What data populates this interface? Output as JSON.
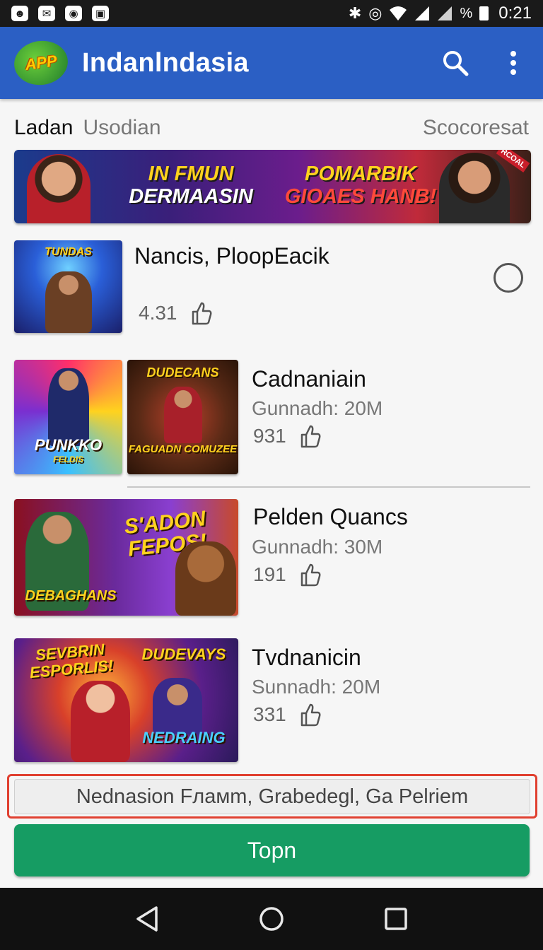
{
  "status_bar": {
    "left_icons": [
      "notification-icon",
      "chat-icon",
      "app-icon",
      "gallery-icon"
    ],
    "right_icons": [
      "bluetooth-icon",
      "sync-icon",
      "wifi-icon",
      "signal-icon",
      "battery-icon"
    ],
    "percent_symbol": "%",
    "time": "0:21"
  },
  "app_bar": {
    "logo_text": "APP",
    "title": "Indanlndasia",
    "actions": [
      "search-icon",
      "more-vert-icon"
    ]
  },
  "tabs": {
    "active": "Ladan",
    "inactive": "Usodian",
    "right": "Scocoresat"
  },
  "banner": {
    "left_line1": "IN FMUN",
    "left_line2": "DERMAASIN",
    "right_line1": "POMARBIK",
    "right_line2": "GIOAES HANB!",
    "corner": "RCOAL"
  },
  "items": [
    {
      "title": "Nancis, PloopEacik",
      "count": "4.31",
      "thumb_text": "TUNDAS"
    },
    {
      "title": "Cadnaniain",
      "subtitle": "Gunnadh: 20M",
      "count": "931",
      "thumb1_text": "PUNKKO",
      "thumb1_sub": "FELDIS",
      "thumb2_text": "DUDECANS",
      "thumb2_sub": "FAGUADN COMUZEE"
    },
    {
      "title": "Pelden Quancs",
      "subtitle": "Gunnadh: 30M",
      "count": "191",
      "thumb_text": "S'ADON FEPOS!",
      "thumb_sub": "DEBAGHANS"
    },
    {
      "title": "Tvdnanicin",
      "subtitle": "Sunnadh: 20M",
      "count": "331",
      "thumb_text": "SEVBRIN ESPORLIS!",
      "thumb_text2": "DUDEVAYS",
      "thumb_sub": "NEDRAING"
    }
  ],
  "search_chip": "Nednasion Fламm, Grabedegl, Ga Pelriem",
  "primary_button": "Topn",
  "nav": [
    "back-icon",
    "home-icon",
    "recents-icon"
  ],
  "colors": {
    "app_bar": "#2b5fc4",
    "primary_button": "#169c63",
    "highlight": "#e04030"
  }
}
